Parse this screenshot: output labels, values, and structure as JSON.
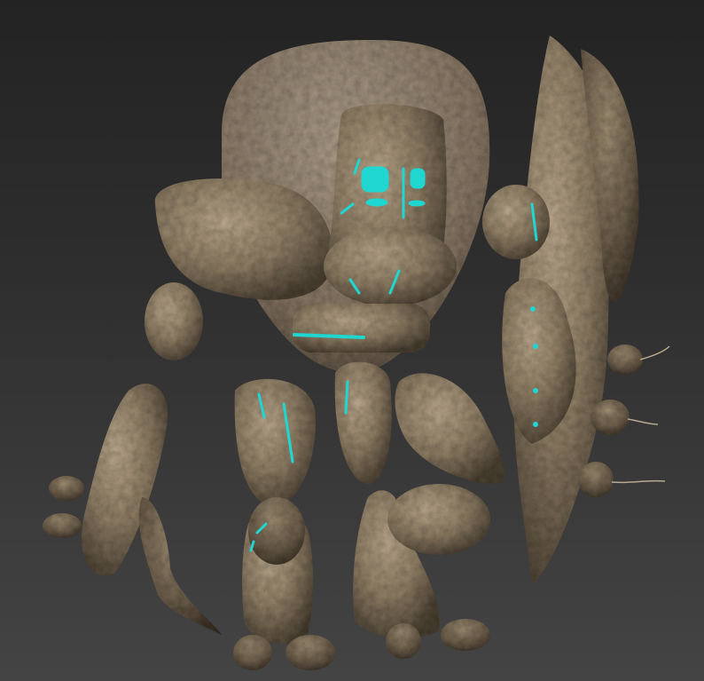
{
  "viewport": {
    "background_top": "#232323",
    "background_bottom": "#444444"
  },
  "model": {
    "stone_light": "#b7a58a",
    "stone_mid": "#8a7a62",
    "stone_dark": "#4a4033",
    "glow": "#1fd6d0"
  }
}
